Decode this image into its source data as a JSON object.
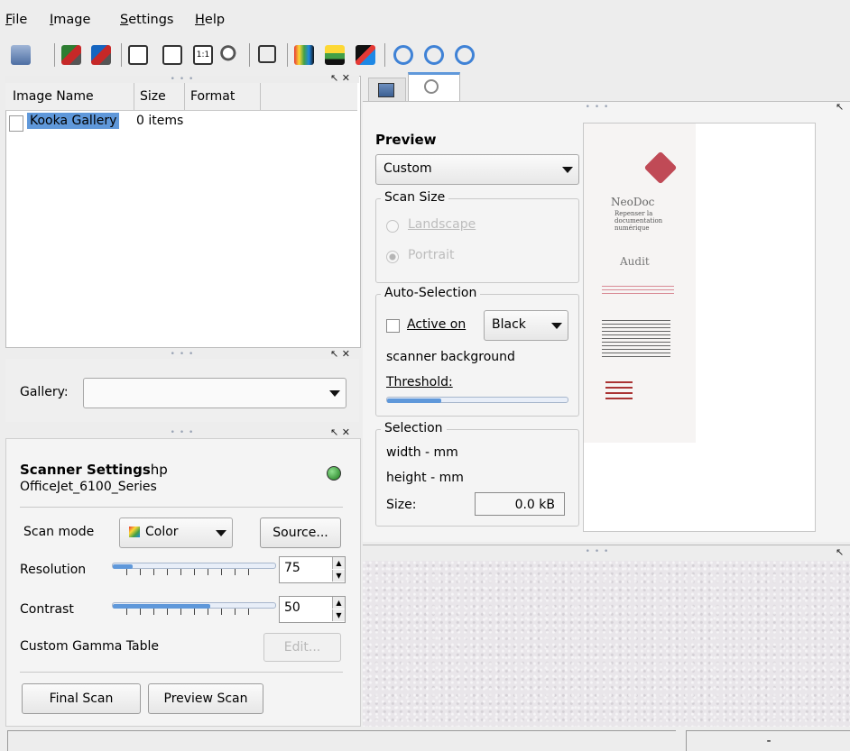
{
  "menubar": {
    "items": [
      {
        "label": "File",
        "underline": "F",
        "rest": "ile"
      },
      {
        "label": "Image",
        "underline": "I",
        "rest": "mage"
      },
      {
        "label": "Settings",
        "underline": "S",
        "rest": "ettings"
      },
      {
        "label": "Help",
        "underline": "H",
        "rest": "elp"
      }
    ]
  },
  "toolbar": {
    "icons": [
      "print-icon",
      "scan-to-gallery-icon",
      "scan-to-gallery-alt-icon",
      "fit-height-icon",
      "fit-width-icon",
      "actual-size-icon",
      "ocr-icon",
      "crop-icon",
      "mirror-horizontal-icon",
      "mirror-vertical-icon",
      "mirror-both-icon",
      "rotate-clockwise-icon",
      "rotate-counterclockwise-icon",
      "rotate-180-icon"
    ]
  },
  "gallery_list": {
    "columns": [
      "Image Name",
      "Size",
      "Format"
    ],
    "rows": [
      {
        "name": "Kooka Gallery",
        "size": "0 items",
        "format": ""
      }
    ]
  },
  "gallery_selector": {
    "label": "Gallery:",
    "value": ""
  },
  "scanner": {
    "title_bold": "Scanner Settings",
    "title_rest": "hp",
    "device": "OfficeJet_6100_Series",
    "status_color": "#2e9e2e",
    "scan_mode": {
      "label": "Scan mode",
      "value": "Color"
    },
    "source_button": "Source...",
    "resolution": {
      "label": "Resolution",
      "value": "75",
      "fraction": 0.12
    },
    "contrast": {
      "label": "Contrast",
      "value": "50",
      "fraction": 0.6
    },
    "gamma": {
      "label": "Custom Gamma Table",
      "button": "Edit..."
    },
    "final_scan": "Final Scan",
    "preview_scan": "Preview Scan"
  },
  "preview": {
    "heading": "Preview",
    "size_combo": "Custom",
    "scan_size": {
      "title": "Scan Size",
      "landscape": "Landscape",
      "portrait": "Portrait"
    },
    "auto_selection": {
      "title": "Auto-Selection",
      "active_on": "Active on",
      "color_value": "Black",
      "background": "scanner background",
      "threshold": "Threshold:",
      "threshold_fraction": 0.3
    },
    "selection": {
      "title": "Selection",
      "width": "width - mm",
      "height": "height - mm",
      "size_label": "Size:",
      "size_value": "0.0 kB"
    },
    "document": {
      "brand": "NeoDoc",
      "tagline_1": "Repenser la",
      "tagline_2": "documentation",
      "tagline_3": "numérique",
      "section": "Audit"
    }
  },
  "statusbar": {
    "left": "",
    "right": "-"
  },
  "colors": {
    "selection": "#5f98da",
    "tab_active": "#ffffff"
  }
}
